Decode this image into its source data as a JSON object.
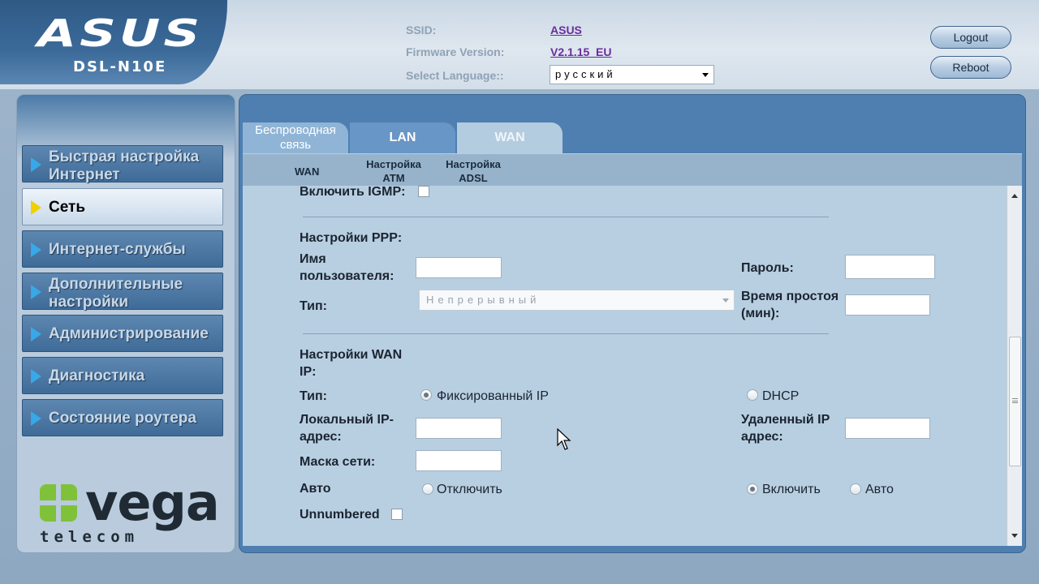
{
  "header": {
    "brand": "ASUS",
    "model": "DSL-N10E",
    "ssid_label": "SSID:",
    "ssid_value": "ASUS",
    "firmware_label": "Firmware Version:",
    "firmware_value": "V2.1.15_EU",
    "language_label": "Select Language::",
    "language_value": "русский",
    "logout_label": "Logout",
    "reboot_label": "Reboot"
  },
  "sidebar": {
    "items": [
      {
        "label": "Быстрая настройка\nИнтернет",
        "active": false
      },
      {
        "label": "Сеть",
        "active": true
      },
      {
        "label": "Интернет-службы",
        "active": false
      },
      {
        "label": "Дополнительные\nнастройки",
        "active": false
      },
      {
        "label": "Администрирование",
        "active": false
      },
      {
        "label": "Диагностика",
        "active": false
      },
      {
        "label": "Состояние роутера",
        "active": false
      }
    ],
    "logo_word": "vega",
    "logo_sub": "telecom"
  },
  "tabs": [
    {
      "label": "Беспроводная связь"
    },
    {
      "label": "LAN"
    },
    {
      "label": "WAN"
    }
  ],
  "subtabs": [
    {
      "label": "WAN"
    },
    {
      "label": "Настройка ATM"
    },
    {
      "label": "Настройка ADSL"
    }
  ],
  "form": {
    "igmp_label": "Включить IGMP:",
    "ppp_section": "Настройки PPP:",
    "username_label": "Имя пользователя:",
    "username_value": "",
    "password_label": "Пароль:",
    "password_value": "",
    "type_label": "Тип:",
    "type_value": "Непрерывный",
    "idle_label": "Время простоя (мин):",
    "idle_value": "",
    "wanip_section": "Настройки WAN IP:",
    "ip_type_label": "Тип:",
    "fixed_ip_label": "Фиксированный IP",
    "dhcp_label": "DHCP",
    "local_ip_label": "Локальный IP-адрес:",
    "local_ip_value": "",
    "remote_ip_label": "Удаленный IP адрес:",
    "remote_ip_value": "",
    "mask_label": "Маска сети:",
    "mask_value": "",
    "auto_label": "Авто",
    "disable_label": "Отключить",
    "enable_label": "Включить",
    "auto_option_label": "Авто",
    "unnumbered_label": "Unnumbered"
  },
  "colors": {
    "header_bg": "#d3dee9",
    "panel_blue": "#4e7fb0",
    "content_bg": "#b8cfe2",
    "link_purple": "#6a2ca0",
    "menu_arrow": "#38a8e8",
    "active_arrow": "#f0d000",
    "vega_green": "#7fc23a"
  }
}
